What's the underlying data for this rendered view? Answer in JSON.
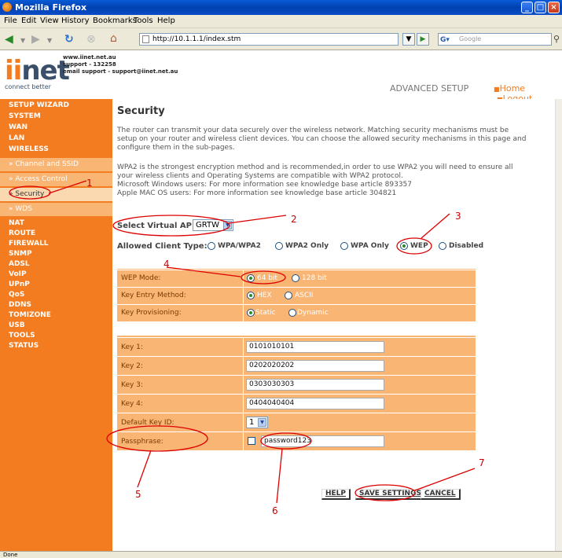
{
  "window": {
    "title": "Mozilla Firefox"
  },
  "menu": [
    "File",
    "Edit",
    "View",
    "History",
    "Bookmarks",
    "Tools",
    "Help"
  ],
  "toolbar": {
    "url": "http://10.1.1.1/index.stm",
    "search_placeholder": "Google"
  },
  "brand": {
    "logo": "iinet",
    "tagline": "connect better",
    "contact": [
      "www.iinet.net.au",
      "support - 132258",
      "email support - support@iinet.net.au"
    ],
    "advanced_setup": "ADVANCED SETUP",
    "home": "Home",
    "logout": "Logout"
  },
  "sidebar": {
    "items": [
      "SETUP WIZARD",
      "SYSTEM",
      "WAN",
      "LAN",
      "WIRELESS"
    ],
    "subitems": [
      "» Channel and SSID",
      "» Access Control",
      "» Security",
      "» WDS"
    ],
    "items2": [
      "NAT",
      "ROUTE",
      "FIREWALL",
      "SNMP",
      "ADSL",
      "VoIP",
      "UPnP",
      "QoS",
      "DDNS",
      "TOMIZONE",
      "USB",
      "TOOLS",
      "STATUS"
    ]
  },
  "page": {
    "title": "Security",
    "para1": [
      "The router can transmit your data securely over the wireless network. Matching security mechanisms must be",
      "setup on your router and wireless client devices. You can choose the allowed security mechanisms in this page and",
      "configure them in the sub-pages."
    ],
    "para2": [
      "WPA2 is the strongest encryption method and is recommended,in order to use WPA2 you will need to ensure all",
      "your wireless clients and Operating Systems are compatible with WPA2 protocol.",
      "Microsoft Windows users: For more information see knowledge base article 893357",
      "Apple MAC OS users: For more information see knowledge base article 304821"
    ],
    "virtual_ap_label": "Select Virtual AP:",
    "virtual_ap_value": "GRTW",
    "client_type_label": "Allowed Client Type:",
    "client_types": [
      "WPA/WPA2",
      "WPA2 Only",
      "WPA Only",
      "WEP",
      "Disabled"
    ],
    "wep_mode_label": "WEP Mode:",
    "wep_modes": [
      "64 bit",
      "128 bit"
    ],
    "key_entry_label": "Key Entry Method:",
    "key_entry": [
      "HEX",
      "ASCII"
    ],
    "key_prov_label": "Key Provisioning:",
    "key_prov": [
      "Static",
      "Dynamic"
    ],
    "keys": [
      {
        "label": "Key 1:",
        "value": "0101010101"
      },
      {
        "label": "Key 2:",
        "value": "0202020202"
      },
      {
        "label": "Key 3:",
        "value": "0303030303"
      },
      {
        "label": "Key 4:",
        "value": "0404040404"
      }
    ],
    "default_key_label": "Default Key ID:",
    "default_key_value": "1",
    "passphrase_label": "Passphrase:",
    "passphrase_value": "password123",
    "buttons": {
      "help": "HELP",
      "save": "SAVE SETTINGS",
      "cancel": "CANCEL"
    }
  },
  "annotations": [
    "1",
    "2",
    "3",
    "4",
    "5",
    "6",
    "7"
  ],
  "statusbar": "Done"
}
